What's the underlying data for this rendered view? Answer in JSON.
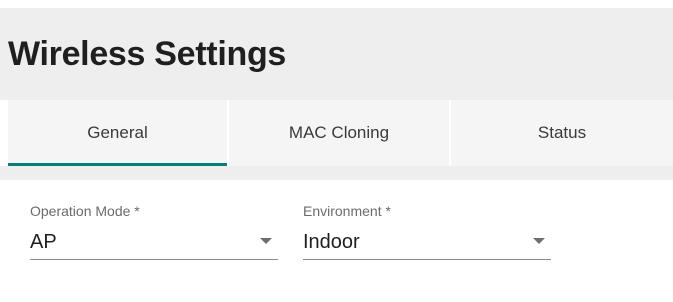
{
  "header": {
    "title": "Wireless Settings"
  },
  "tabs": [
    {
      "label": "General",
      "active": true
    },
    {
      "label": "MAC Cloning",
      "active": false
    },
    {
      "label": "Status",
      "active": false
    }
  ],
  "form": {
    "operation_mode": {
      "label": "Operation Mode *",
      "value": "AP",
      "icon": "chevron-down-icon"
    },
    "environment": {
      "label": "Environment *",
      "value": "Indoor",
      "icon": "chevron-down-icon"
    }
  },
  "colors": {
    "accent": "#0a7e7a",
    "background": "#eeeeee",
    "text": "#1f1f1f"
  }
}
